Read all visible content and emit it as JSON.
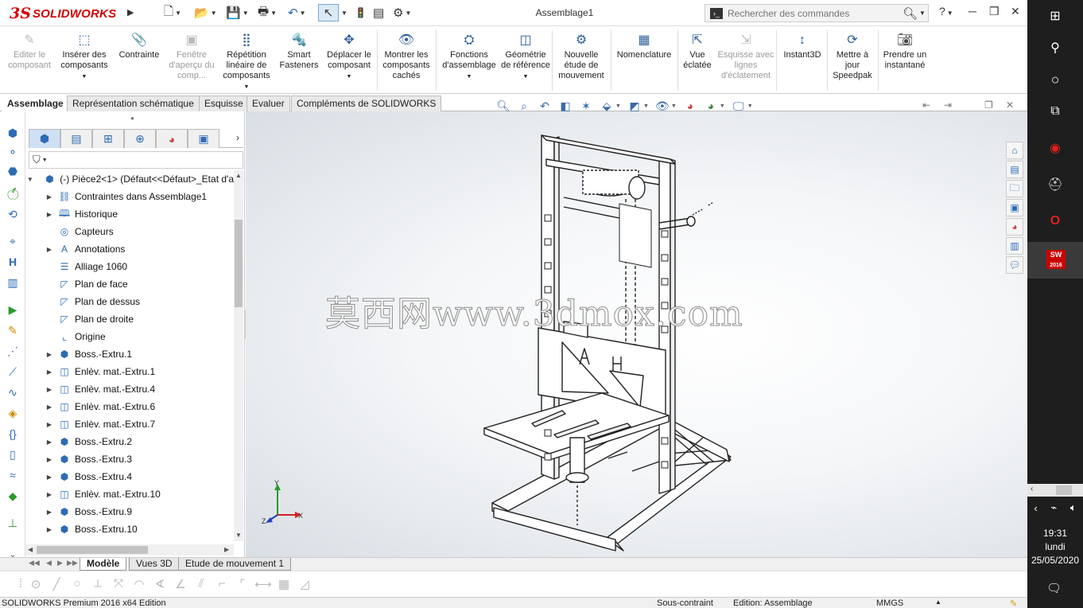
{
  "app": {
    "brand_symbol": "3S",
    "brand_name": "SOLIDWORKS",
    "document_title": "Assemblage1",
    "search_placeholder": "Rechercher des commandes"
  },
  "command_manager": [
    {
      "label": "Editer le composant",
      "icon": "edit-component-icon",
      "disabled": true
    },
    {
      "label": "Insérer des composants",
      "icon": "insert-components-icon",
      "disabled": false
    },
    {
      "label": "Contrainte",
      "icon": "mate-icon",
      "disabled": false
    },
    {
      "label": "Fenêtre d'aperçu du comp...",
      "icon": "preview-window-icon",
      "disabled": true
    },
    {
      "label": "Répétition linéaire de composants",
      "icon": "linear-pattern-icon",
      "disabled": false
    },
    {
      "label": "Smart Fasteners",
      "icon": "smart-fasteners-icon",
      "disabled": false
    },
    {
      "label": "Déplacer le composant",
      "icon": "move-component-icon",
      "disabled": false
    },
    {
      "label": "Montrer les composants cachés",
      "icon": "show-hidden-icon",
      "disabled": false
    },
    {
      "label": "Fonctions d'assemblage",
      "icon": "assembly-features-icon",
      "disabled": false
    },
    {
      "label": "Géométrie de référence",
      "icon": "reference-geometry-icon",
      "disabled": false
    },
    {
      "label": "Nouvelle étude de mouvement",
      "icon": "motion-study-icon",
      "disabled": false
    },
    {
      "label": "Nomenclature",
      "icon": "bom-icon",
      "disabled": false
    },
    {
      "label": "Vue éclatée",
      "icon": "exploded-view-icon",
      "disabled": false
    },
    {
      "label": "Esquisse avec lignes d'éclatement",
      "icon": "explode-line-sketch-icon",
      "disabled": true
    },
    {
      "label": "Instant3D",
      "icon": "instant3d-icon",
      "disabled": false
    },
    {
      "label": "Mettre à jour Speedpak",
      "icon": "speedpak-icon",
      "disabled": false
    },
    {
      "label": "Prendre un instantané",
      "icon": "snapshot-icon",
      "disabled": false
    }
  ],
  "cm_tabs": [
    "Assemblage",
    "Représentation schématique",
    "Esquisse",
    "Evaluer",
    "Compléments de SOLIDWORKS"
  ],
  "feature_tree": {
    "root": "(-) Pièce2<1> (Défaut<<Défaut>_Etat d'a",
    "items": [
      {
        "label": "Contraintes dans Assemblage1",
        "icon": "mates-folder-icon",
        "expandable": true
      },
      {
        "label": "Historique",
        "icon": "history-icon",
        "expandable": true
      },
      {
        "label": "Capteurs",
        "icon": "sensors-icon",
        "expandable": false
      },
      {
        "label": "Annotations",
        "icon": "annotations-icon",
        "expandable": true
      },
      {
        "label": "Alliage 1060",
        "icon": "material-icon",
        "expandable": false
      },
      {
        "label": "Plan de face",
        "icon": "plane-icon",
        "expandable": false
      },
      {
        "label": "Plan de dessus",
        "icon": "plane-icon",
        "expandable": false
      },
      {
        "label": "Plan de droite",
        "icon": "plane-icon",
        "expandable": false
      },
      {
        "label": "Origine",
        "icon": "origin-icon",
        "expandable": false
      },
      {
        "label": "Boss.-Extru.1",
        "icon": "extrude-boss-icon",
        "expandable": true
      },
      {
        "label": "Enlèv. mat.-Extru.1",
        "icon": "extrude-cut-icon",
        "expandable": true
      },
      {
        "label": "Enlèv. mat.-Extru.4",
        "icon": "extrude-cut-icon",
        "expandable": true
      },
      {
        "label": "Enlèv. mat.-Extru.6",
        "icon": "extrude-cut-icon",
        "expandable": true
      },
      {
        "label": "Enlèv. mat.-Extru.7",
        "icon": "extrude-cut-icon",
        "expandable": true
      },
      {
        "label": "Boss.-Extru.2",
        "icon": "extrude-boss-icon",
        "expandable": true
      },
      {
        "label": "Boss.-Extru.3",
        "icon": "extrude-boss-icon",
        "expandable": true
      },
      {
        "label": "Boss.-Extru.4",
        "icon": "extrude-boss-icon",
        "expandable": true
      },
      {
        "label": "Enlèv. mat.-Extru.10",
        "icon": "extrude-cut-icon",
        "expandable": true
      },
      {
        "label": "Boss.-Extru.9",
        "icon": "extrude-boss-icon",
        "expandable": true
      },
      {
        "label": "Boss.-Extru.10",
        "icon": "extrude-boss-icon",
        "expandable": true
      }
    ]
  },
  "viewport": {
    "watermark": "莫西网www.3dmox.com",
    "triad": {
      "x": "X",
      "y": "Y",
      "z": "Z"
    }
  },
  "bottom_tabs": [
    "Modèle",
    "Vues 3D",
    "Etude de mouvement 1"
  ],
  "status_bar": {
    "edition": "SOLIDWORKS Premium 2016 x64 Edition",
    "state": "Sous-contraint",
    "editing": "Edition: Assemblage",
    "units": "MMGS"
  },
  "taskbar": {
    "time": "19:31",
    "day": "lundi",
    "date": "25/05/2020",
    "sw_badge": "SW",
    "sw_year": "2016"
  }
}
